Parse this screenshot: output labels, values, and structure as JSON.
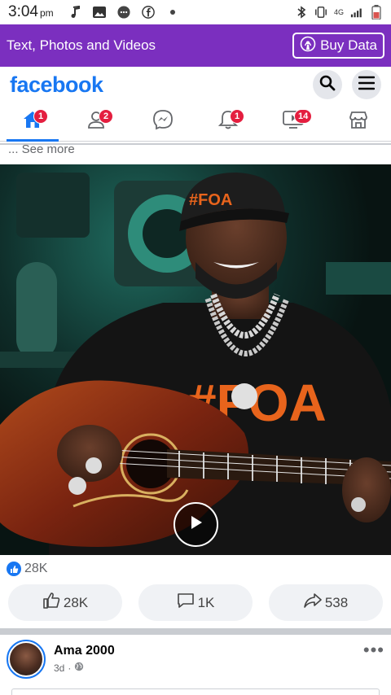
{
  "status_bar": {
    "time": "3:04",
    "ampm": "pm",
    "network": "4G",
    "icons": [
      "music-note-icon",
      "image-icon",
      "messages-icon",
      "facebook-icon",
      "dot-icon",
      "bluetooth-icon",
      "vibrate-icon",
      "signal-icon",
      "battery-icon"
    ]
  },
  "promo_banner": {
    "text": "Text, Photos and Videos",
    "button_label": "Buy Data",
    "background": "#7b2fbf"
  },
  "header": {
    "logo": "facebook",
    "brand_color": "#1877f2"
  },
  "nav": {
    "tabs": [
      {
        "name": "home",
        "badge": "1",
        "active": true
      },
      {
        "name": "friends",
        "badge": "2"
      },
      {
        "name": "messenger",
        "badge": ""
      },
      {
        "name": "notifications",
        "badge": "1"
      },
      {
        "name": "watch",
        "badge": "14"
      },
      {
        "name": "marketplace",
        "badge": ""
      }
    ]
  },
  "post": {
    "see_more": "... See more",
    "reactions_count": "28K",
    "like_count": "28K",
    "comment_count": "1K",
    "share_count": "538",
    "video_cap_text": "#FOA",
    "video_shirt_text": "#FOA"
  },
  "next_post": {
    "author": "Ama 2000",
    "time": "3d",
    "separator": "·"
  }
}
